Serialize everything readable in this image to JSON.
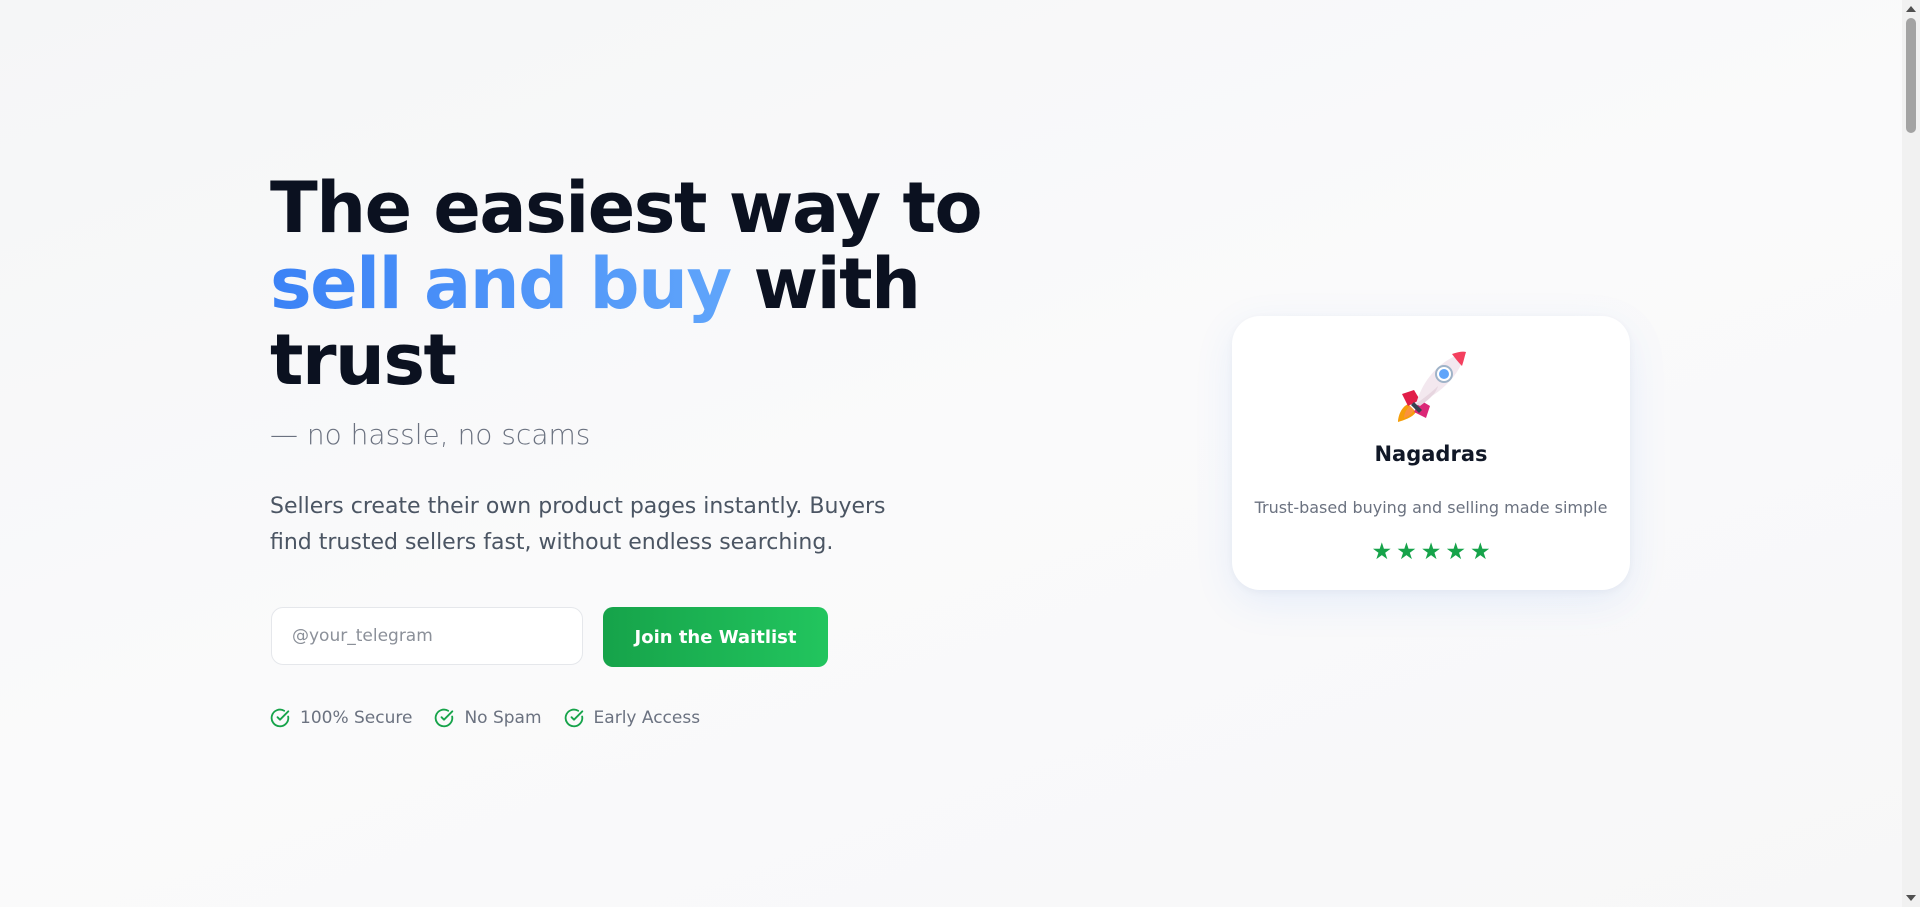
{
  "hero": {
    "headline_part1": "The easiest way to",
    "headline_accent": "sell and buy",
    "headline_part2": "with trust",
    "tagline": "— no hassle, no scams",
    "description": "Sellers create their own product pages instantly. Buyers find trusted sellers fast, without endless searching."
  },
  "signup": {
    "input_placeholder": "@your_telegram",
    "input_value": "",
    "button_label": "Join the Waitlist"
  },
  "badges": [
    {
      "label": "100% Secure",
      "icon": "check-circle-icon"
    },
    {
      "label": "No Spam",
      "icon": "check-circle-icon"
    },
    {
      "label": "Early Access",
      "icon": "check-circle-icon"
    }
  ],
  "card": {
    "icon": "rocket-icon",
    "title": "Nagadras",
    "subtitle": "Trust-based buying and selling made simple",
    "rating": 5,
    "rating_max": 5
  },
  "colors": {
    "accent_blue": "#3b82f6",
    "accent_green": "#16a34a",
    "heading": "#0b1120",
    "muted_text": "#6b7280"
  }
}
